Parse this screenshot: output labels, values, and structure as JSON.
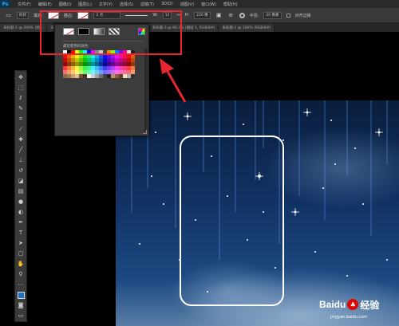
{
  "app": {
    "logo": "Ps"
  },
  "menu": [
    "文件(F)",
    "编辑(E)",
    "图像(I)",
    "图层(L)",
    "文字(Y)",
    "选择(S)",
    "滤镜(T)",
    "3D(D)",
    "视图(V)",
    "窗口(W)",
    "帮助(H)"
  ],
  "options": {
    "mode": "形状",
    "fill_label": "填充:",
    "stroke_label": "描边:",
    "stroke_width": "2 点",
    "w_label": "W:",
    "w_value": "12",
    "h_label": "H:",
    "h_value": "220 像",
    "radius_label": "半径:",
    "radius_value": "20 像素",
    "align_edges": "对齐边缘"
  },
  "tabs": [
    "未标题-1 @ 200% (图...",
    "未标题-1 @ 66.7% (...",
    "未标题-2 @ 66.7% (RGB/8#)",
    "未标题-3 @ 66.7% (图层 1, RGB/8#)",
    "未标题-1 @ 100% (RGB/8#)"
  ],
  "fill_dropdown": {
    "recent_colors_label": "最近使用的颜色",
    "icons": [
      "no-color-icon",
      "solid-color-icon",
      "gradient-icon",
      "pattern-icon",
      "color-picker-icon"
    ]
  },
  "colors": {
    "highlight": "#e8272f",
    "foreground_color": "#1f6fc0"
  },
  "watermark": {
    "brand": "Baidu",
    "sub": "jingyan.baidu.com",
    "product": "经验"
  }
}
